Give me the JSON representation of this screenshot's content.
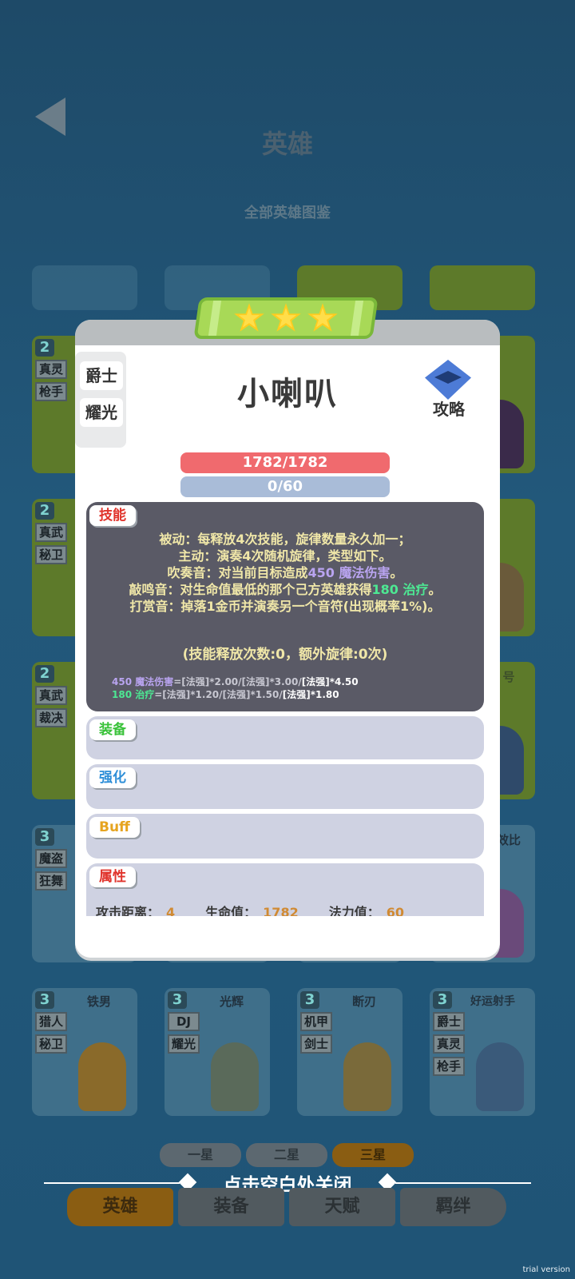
{
  "page": {
    "title": "英雄",
    "subtitle": "全部英雄图鉴"
  },
  "cards_row_a": [
    {
      "star": "2",
      "traits": [
        "真灵",
        "枪手"
      ]
    },
    {
      "star": "2",
      "traits": [
        "真武",
        "秘卫"
      ]
    },
    {
      "star": "2",
      "traits": [
        "真武",
        "裁决"
      ]
    },
    {
      "star": "3",
      "traits": [
        "魔盗",
        "狂舞"
      ]
    }
  ],
  "cards_row_b": [
    {
      "star": "3",
      "name": "铁男",
      "traits": [
        "猎人",
        "秘卫"
      ]
    },
    {
      "star": "3",
      "name": "光辉",
      "traits": [
        "DJ",
        "耀光"
      ]
    },
    {
      "star": "3",
      "name": "断刃",
      "traits": [
        "机甲",
        "剑士"
      ]
    },
    {
      "star": "3",
      "name": "好运射手",
      "traits": [
        "爵士",
        "真灵",
        "枪手"
      ]
    }
  ],
  "right_peek_labels": [
    "号",
    "效比"
  ],
  "modal": {
    "hero_name": "小喇叭",
    "traits": [
      "爵士",
      "耀光"
    ],
    "guide_label": "攻略",
    "hp": "1782/1782",
    "mp": "0/60",
    "skill": {
      "tag": "技能",
      "line1": "被动：每释放4次技能，旋律数量永久加一；",
      "line2": "主动：演奏4次随机旋律，类型如下。",
      "line3_pre": "吹奏音：对当前目标造成",
      "line3_hl": "450 魔法伤害",
      "line3_post": "。",
      "line4_pre": "敲鸣音：对生命值最低的那个己方英雄获得",
      "line4_hl": "180 治疗",
      "line4_post": "。",
      "line5": "打赏音：掉落1金币并演奏另一个音符(出现概率1%)。",
      "count": "(技能释放次数:0，额外旋律:0次)",
      "formula1_hl": "450 魔法伤害",
      "formula1_rest": "=[法强]*2.00/[法强]*3.00/",
      "formula1_end": "[法强]*4.50",
      "formula2_hl": "180 治疗",
      "formula2_rest": "=[法强]*1.20/[法强]*1.50/",
      "formula2_end": "[法强]*1.80"
    },
    "equip_tag": "装备",
    "enhance_tag": "强化",
    "buff_tag": "Buff",
    "attr": {
      "tag": "属性",
      "range_label": "攻击距离：",
      "range_value": "4",
      "hp_label": "生命值：",
      "hp_value": "1782",
      "mp_label": "法力值：",
      "mp_value": "60"
    },
    "star_count": 3
  },
  "star_filters": [
    "一星",
    "二星",
    "三星"
  ],
  "close_hint": "点击空白处关闭",
  "nav_tabs": [
    "英雄",
    "装备",
    "天赋",
    "羁绊"
  ],
  "watermark": "trial version",
  "colors": {
    "tag_skill": "#e0332b",
    "tag_equip": "#3ac23a",
    "tag_enhance": "#2f8fd8",
    "tag_buff": "#e6a41f",
    "tag_attr": "#e0332b"
  }
}
